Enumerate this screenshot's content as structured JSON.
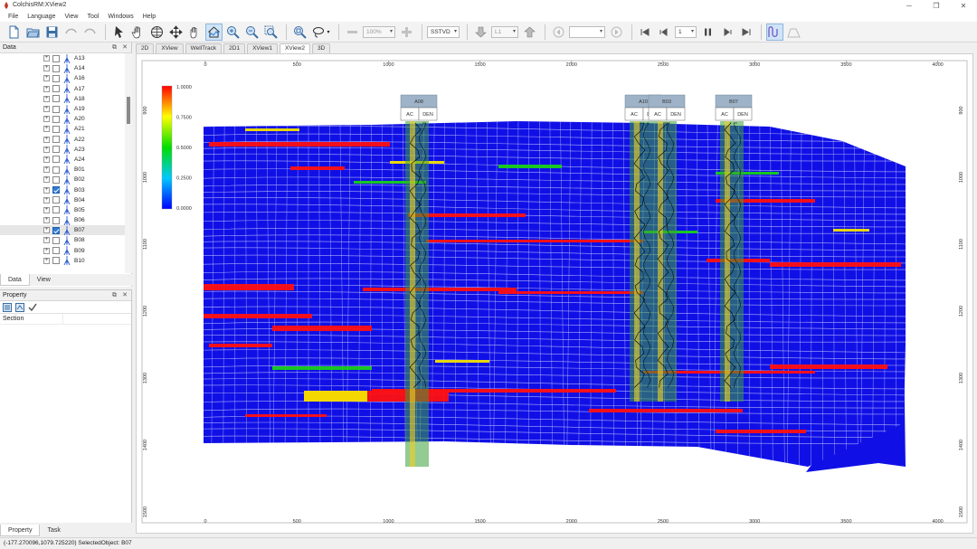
{
  "window": {
    "title": "ColchisRM:XView2",
    "buttons": [
      "─",
      "❐",
      "✕"
    ]
  },
  "menu": [
    "File",
    "Language",
    "View",
    "Tool",
    "Windows",
    "Help"
  ],
  "toolbar": {
    "zoom_value": "100%",
    "depth_mode": "SSTVD",
    "layer_value": "L1",
    "blank_combo": "",
    "frame_value": "1"
  },
  "data_panel": {
    "title": "Data",
    "wells": [
      {
        "name": "A13",
        "checked": false
      },
      {
        "name": "A14",
        "checked": false
      },
      {
        "name": "A16",
        "checked": false
      },
      {
        "name": "A17",
        "checked": false
      },
      {
        "name": "A18",
        "checked": false
      },
      {
        "name": "A19",
        "checked": false
      },
      {
        "name": "A20",
        "checked": false
      },
      {
        "name": "A21",
        "checked": false
      },
      {
        "name": "A22",
        "checked": false
      },
      {
        "name": "A23",
        "checked": false
      },
      {
        "name": "A24",
        "checked": false
      },
      {
        "name": "B01",
        "checked": false
      },
      {
        "name": "B02",
        "checked": false
      },
      {
        "name": "B03",
        "checked": true
      },
      {
        "name": "B04",
        "checked": false
      },
      {
        "name": "B05",
        "checked": false
      },
      {
        "name": "B06",
        "checked": false
      },
      {
        "name": "B07",
        "checked": true,
        "selected": true
      },
      {
        "name": "B08",
        "checked": false
      },
      {
        "name": "B09",
        "checked": false
      },
      {
        "name": "B10",
        "checked": false
      }
    ],
    "tabs": [
      "Data",
      "View"
    ]
  },
  "property_panel": {
    "title": "Property",
    "row_key": "Section",
    "tabs": [
      "Property",
      "Task"
    ]
  },
  "view_tabs": [
    "2D",
    "XView",
    "WellTrack",
    "2D1",
    "XView1",
    "XView2",
    "3D"
  ],
  "active_view_tab": "XView2",
  "plot": {
    "x_ticks": [
      "0",
      "500",
      "1000",
      "1500",
      "2000",
      "2500",
      "3000",
      "3500",
      "4000"
    ],
    "y_ticks": [
      "900",
      "1000",
      "1100",
      "1200",
      "1300",
      "1400",
      "1500"
    ],
    "colorbar_labels": [
      "1.0000",
      "0.7500",
      "0.5000",
      "0.2500",
      "0.0000"
    ],
    "wells": [
      {
        "name": "A08",
        "logs": [
          "AC",
          "DEN"
        ]
      },
      {
        "name": "A10",
        "logs": [
          "AC",
          "DEN"
        ]
      },
      {
        "name": "B03",
        "logs": [
          "AC",
          "DEN"
        ]
      },
      {
        "name": "B07",
        "logs": [
          "AC",
          "DEN"
        ]
      }
    ],
    "colors": {
      "background": "#1010e6",
      "grid": "#c8c8ff",
      "high": "#ff1010",
      "mid": "#18d018"
    }
  },
  "status": {
    "text": "(-177.270096,1079.725220)  SelectedObject:  B07"
  }
}
